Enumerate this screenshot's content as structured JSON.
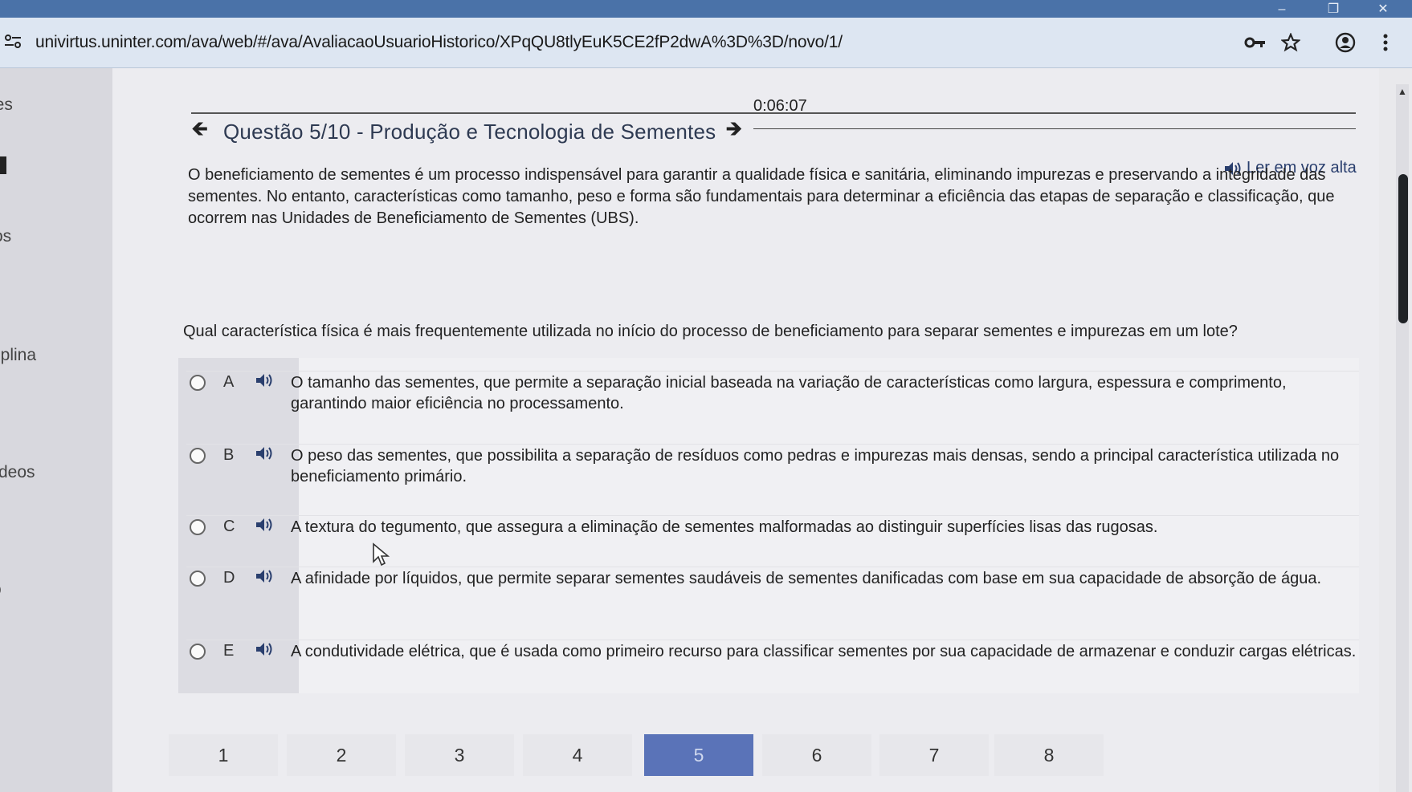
{
  "browser": {
    "url": "univirtus.uninter.com/ava/web/#/ava/AvaliacaoUsuarioHistorico/XPqQU8tlyEuK5CE2fP2dwA%3D%3D/novo/1/",
    "window_buttons": [
      "–",
      "❐",
      "✕"
    ]
  },
  "sidebar": {
    "items": [
      {
        "label": "ões"
      },
      {
        "label": "os"
      },
      {
        "label": "iplina"
      },
      {
        "label": "deos"
      },
      {
        "label": "o"
      }
    ]
  },
  "exam": {
    "timer": "0:06:07",
    "title": "Questão 5/10 - Produção e Tecnologia de Sementes",
    "read_aloud": "Ler em voz alta",
    "stem": "O beneficiamento de sementes é um processo indispensável para garantir a qualidade física e sanitária, eliminando impurezas e preservando a integridade das sementes. No entanto, características como tamanho, peso e forma são fundamentais para determinar a eficiência das etapas de separação e classificação, que ocorrem nas Unidades de Beneficiamento de Sementes (UBS).",
    "question": "Qual característica física é mais frequentemente utilizada no início do processo de beneficiamento para separar sementes e impurezas em um lote?",
    "options": [
      {
        "letter": "A",
        "text": "O tamanho das sementes, que permite a separação inicial baseada na variação de características como largura, espessura e comprimento, garantindo maior eficiência no processamento."
      },
      {
        "letter": "B",
        "text": "O peso das sementes, que possibilita a separação de resíduos como pedras e impurezas mais densas, sendo a principal característica utilizada no beneficiamento primário."
      },
      {
        "letter": "C",
        "text": "A textura do tegumento, que assegura a eliminação de sementes malformadas ao distinguir superfícies lisas das rugosas."
      },
      {
        "letter": "D",
        "text": "A afinidade por líquidos, que permite separar sementes saudáveis de sementes danificadas com base em sua capacidade de absorção de água."
      },
      {
        "letter": "E",
        "text": "A condutividade elétrica, que é usada como primeiro recurso para classificar sementes por sua capacidade de armazenar e conduzir cargas elétricas."
      }
    ]
  },
  "pagination": {
    "pages": [
      "1",
      "2",
      "3",
      "4",
      "5",
      "6",
      "7",
      "8"
    ],
    "active": "5"
  },
  "colors": {
    "active_page": "#5a73b8",
    "title": "#2e3a52",
    "read_aloud": "#2a3f6e"
  }
}
